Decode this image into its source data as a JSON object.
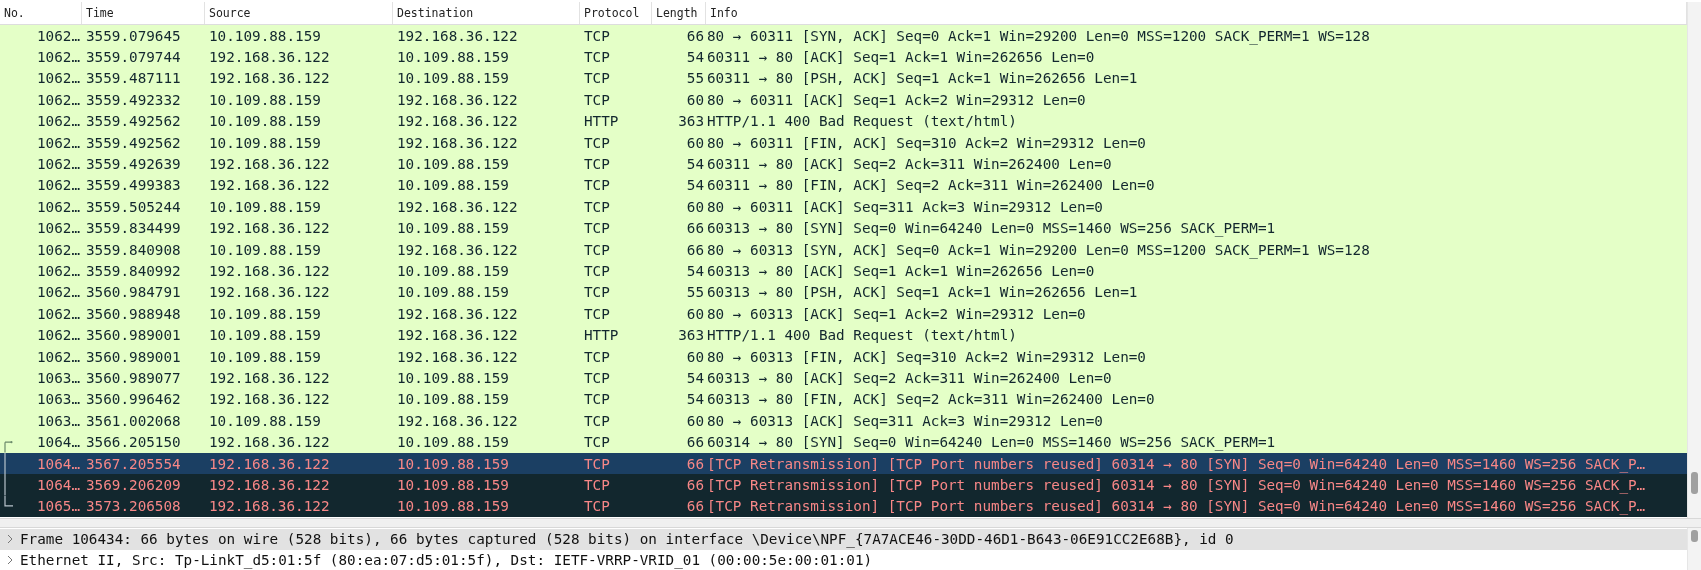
{
  "packet_list": {
    "columns": [
      "No.",
      "Time",
      "Source",
      "Destination",
      "Protocol",
      "Length",
      "Info"
    ],
    "rows": [
      {
        "no": "1062…",
        "time": "3559.079645",
        "source": "10.109.88.159",
        "destination": "192.168.36.122",
        "protocol": "TCP",
        "length": "66",
        "info": "80 → 60311 [SYN, ACK] Seq=0 Ack=1 Win=29200 Len=0 MSS=1200 SACK_PERM=1 WS=128",
        "kind": "normal",
        "selected": false,
        "related": false
      },
      {
        "no": "1062…",
        "time": "3559.079744",
        "source": "192.168.36.122",
        "destination": "10.109.88.159",
        "protocol": "TCP",
        "length": "54",
        "info": "60311 → 80 [ACK] Seq=1 Ack=1 Win=262656 Len=0",
        "kind": "normal",
        "selected": false,
        "related": false
      },
      {
        "no": "1062…",
        "time": "3559.487111",
        "source": "192.168.36.122",
        "destination": "10.109.88.159",
        "protocol": "TCP",
        "length": "55",
        "info": "60311 → 80 [PSH, ACK] Seq=1 Ack=1 Win=262656 Len=1",
        "kind": "normal",
        "selected": false,
        "related": false
      },
      {
        "no": "1062…",
        "time": "3559.492332",
        "source": "10.109.88.159",
        "destination": "192.168.36.122",
        "protocol": "TCP",
        "length": "60",
        "info": "80 → 60311 [ACK] Seq=1 Ack=2 Win=29312 Len=0",
        "kind": "normal",
        "selected": false,
        "related": false
      },
      {
        "no": "1062…",
        "time": "3559.492562",
        "source": "10.109.88.159",
        "destination": "192.168.36.122",
        "protocol": "HTTP",
        "length": "363",
        "info": "HTTP/1.1 400 Bad Request  (text/html)",
        "kind": "normal",
        "selected": false,
        "related": false
      },
      {
        "no": "1062…",
        "time": "3559.492562",
        "source": "10.109.88.159",
        "destination": "192.168.36.122",
        "protocol": "TCP",
        "length": "60",
        "info": "80 → 60311 [FIN, ACK] Seq=310 Ack=2 Win=29312 Len=0",
        "kind": "normal",
        "selected": false,
        "related": false
      },
      {
        "no": "1062…",
        "time": "3559.492639",
        "source": "192.168.36.122",
        "destination": "10.109.88.159",
        "protocol": "TCP",
        "length": "54",
        "info": "60311 → 80 [ACK] Seq=2 Ack=311 Win=262400 Len=0",
        "kind": "normal",
        "selected": false,
        "related": false
      },
      {
        "no": "1062…",
        "time": "3559.499383",
        "source": "192.168.36.122",
        "destination": "10.109.88.159",
        "protocol": "TCP",
        "length": "54",
        "info": "60311 → 80 [FIN, ACK] Seq=2 Ack=311 Win=262400 Len=0",
        "kind": "normal",
        "selected": false,
        "related": false
      },
      {
        "no": "1062…",
        "time": "3559.505244",
        "source": "10.109.88.159",
        "destination": "192.168.36.122",
        "protocol": "TCP",
        "length": "60",
        "info": "80 → 60311 [ACK] Seq=311 Ack=3 Win=29312 Len=0",
        "kind": "normal",
        "selected": false,
        "related": false
      },
      {
        "no": "1062…",
        "time": "3559.834499",
        "source": "192.168.36.122",
        "destination": "10.109.88.159",
        "protocol": "TCP",
        "length": "66",
        "info": "60313 → 80 [SYN] Seq=0 Win=64240 Len=0 MSS=1460 WS=256 SACK_PERM=1",
        "kind": "normal",
        "selected": false,
        "related": false
      },
      {
        "no": "1062…",
        "time": "3559.840908",
        "source": "10.109.88.159",
        "destination": "192.168.36.122",
        "protocol": "TCP",
        "length": "66",
        "info": "80 → 60313 [SYN, ACK] Seq=0 Ack=1 Win=29200 Len=0 MSS=1200 SACK_PERM=1 WS=128",
        "kind": "normal",
        "selected": false,
        "related": false
      },
      {
        "no": "1062…",
        "time": "3559.840992",
        "source": "192.168.36.122",
        "destination": "10.109.88.159",
        "protocol": "TCP",
        "length": "54",
        "info": "60313 → 80 [ACK] Seq=1 Ack=1 Win=262656 Len=0",
        "kind": "normal",
        "selected": false,
        "related": false
      },
      {
        "no": "1062…",
        "time": "3560.984791",
        "source": "192.168.36.122",
        "destination": "10.109.88.159",
        "protocol": "TCP",
        "length": "55",
        "info": "60313 → 80 [PSH, ACK] Seq=1 Ack=1 Win=262656 Len=1",
        "kind": "normal",
        "selected": false,
        "related": false
      },
      {
        "no": "1062…",
        "time": "3560.988948",
        "source": "10.109.88.159",
        "destination": "192.168.36.122",
        "protocol": "TCP",
        "length": "60",
        "info": "80 → 60313 [ACK] Seq=1 Ack=2 Win=29312 Len=0",
        "kind": "normal",
        "selected": false,
        "related": false
      },
      {
        "no": "1062…",
        "time": "3560.989001",
        "source": "10.109.88.159",
        "destination": "192.168.36.122",
        "protocol": "HTTP",
        "length": "363",
        "info": "HTTP/1.1 400 Bad Request  (text/html)",
        "kind": "normal",
        "selected": false,
        "related": false
      },
      {
        "no": "1062…",
        "time": "3560.989001",
        "source": "10.109.88.159",
        "destination": "192.168.36.122",
        "protocol": "TCP",
        "length": "60",
        "info": "80 → 60313 [FIN, ACK] Seq=310 Ack=2 Win=29312 Len=0",
        "kind": "normal",
        "selected": false,
        "related": false
      },
      {
        "no": "1063…",
        "time": "3560.989077",
        "source": "192.168.36.122",
        "destination": "10.109.88.159",
        "protocol": "TCP",
        "length": "54",
        "info": "60313 → 80 [ACK] Seq=2 Ack=311 Win=262400 Len=0",
        "kind": "normal",
        "selected": false,
        "related": false
      },
      {
        "no": "1063…",
        "time": "3560.996462",
        "source": "192.168.36.122",
        "destination": "10.109.88.159",
        "protocol": "TCP",
        "length": "54",
        "info": "60313 → 80 [FIN, ACK] Seq=2 Ack=311 Win=262400 Len=0",
        "kind": "normal",
        "selected": false,
        "related": false
      },
      {
        "no": "1063…",
        "time": "3561.002068",
        "source": "10.109.88.159",
        "destination": "192.168.36.122",
        "protocol": "TCP",
        "length": "60",
        "info": "80 → 60313 [ACK] Seq=311 Ack=3 Win=29312 Len=0",
        "kind": "normal",
        "selected": false,
        "related": false
      },
      {
        "no": "1064…",
        "time": "3566.205150",
        "source": "192.168.36.122",
        "destination": "10.109.88.159",
        "protocol": "TCP",
        "length": "66",
        "info": "60314 → 80 [SYN] Seq=0 Win=64240 Len=0 MSS=1460 WS=256 SACK_PERM=1",
        "kind": "normal",
        "selected": false,
        "related": true
      },
      {
        "no": "1064…",
        "time": "3567.205554",
        "source": "192.168.36.122",
        "destination": "10.109.88.159",
        "protocol": "TCP",
        "length": "66",
        "info": "[TCP Retransmission] [TCP Port numbers reused] 60314 → 80 [SYN] Seq=0 Win=64240 Len=0 MSS=1460 WS=256 SACK_P…",
        "kind": "bad",
        "selected": true,
        "related": true
      },
      {
        "no": "1064…",
        "time": "3569.206209",
        "source": "192.168.36.122",
        "destination": "10.109.88.159",
        "protocol": "TCP",
        "length": "66",
        "info": "[TCP Retransmission] [TCP Port numbers reused] 60314 → 80 [SYN] Seq=0 Win=64240 Len=0 MSS=1460 WS=256 SACK_P…",
        "kind": "bad",
        "selected": false,
        "related": true
      },
      {
        "no": "1065…",
        "time": "3573.206508",
        "source": "192.168.36.122",
        "destination": "10.109.88.159",
        "protocol": "TCP",
        "length": "66",
        "info": "[TCP Retransmission] [TCP Port numbers reused] 60314 → 80 [SYN] Seq=0 Win=64240 Len=0 MSS=1460 WS=256 SACK_P…",
        "kind": "bad",
        "selected": false,
        "related": true
      }
    ]
  },
  "packet_details": [
    {
      "text": "Frame 106434: 66 bytes on wire (528 bits), 66 bytes captured (528 bits) on interface \\Device\\NPF_{7A7ACE46-30DD-46D1-B643-06E91CC2E68B}, id 0",
      "expanded": false,
      "selected": true
    },
    {
      "text": "Ethernet II, Src: Tp-LinkT_d5:01:5f (80:ea:07:d5:01:5f), Dst: IETF-VRRP-VRID_01 (00:00:5e:00:01:01)",
      "expanded": false,
      "selected": false
    }
  ]
}
